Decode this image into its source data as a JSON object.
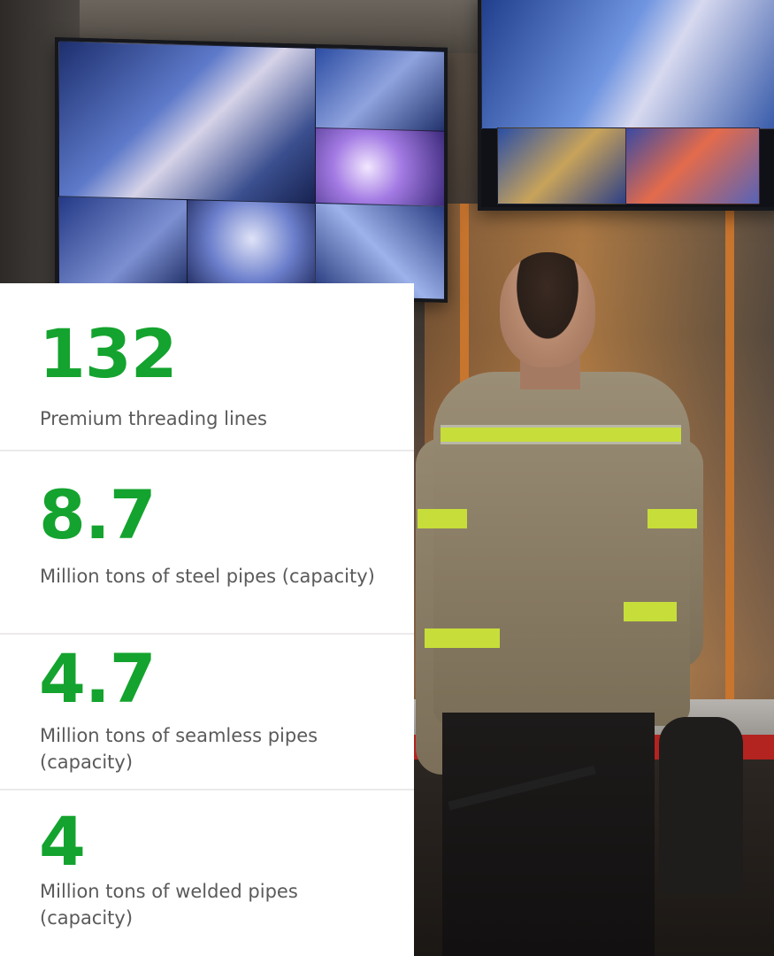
{
  "stats": [
    {
      "value": "132",
      "label": "Premium threading lines"
    },
    {
      "value": "8.7",
      "label": "Million tons of steel pipes (capacity)"
    },
    {
      "value": "4.7",
      "label": "Million tons of seamless pipes (capacity)"
    },
    {
      "value": "4",
      "label": "Million tons of welded pipes (capacity)"
    }
  ],
  "colors": {
    "accent": "#14a32e",
    "label_text": "#5a5a5a",
    "panel_background": "#ffffff"
  }
}
